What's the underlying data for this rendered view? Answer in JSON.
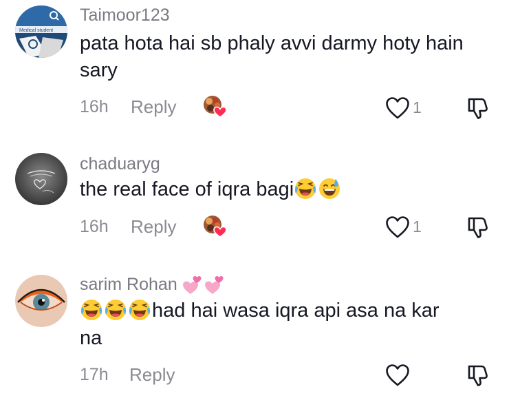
{
  "comments": [
    {
      "username": "Taimoor123",
      "avatar_text": "Medical student",
      "text": "pata hota hai sb phaly avvi darmy hoty hain sary",
      "time": "16h",
      "reply_label": "Reply",
      "like_count": "1"
    },
    {
      "username": "chaduaryg",
      "text": "the real face of iqra bagi",
      "time": "16h",
      "reply_label": "Reply",
      "like_count": "1"
    },
    {
      "username": "sarim Rohan",
      "text_line1": "had hai wasa iqra api asa na kar",
      "text_line2": "na",
      "time": "17h",
      "reply_label": "Reply",
      "like_count": ""
    }
  ],
  "icons": {
    "like": "heart-outline-icon",
    "dislike": "thumbs-down-icon",
    "creator_liked": "creator-liked-badge",
    "emoji_laughing": "tears-of-joy-emoji",
    "emoji_sweat": "grinning-sweat-emoji",
    "emoji_hearts": "two-hearts-emoji"
  },
  "colors": {
    "text": "#161823",
    "secondary": "#8a8b91",
    "heart_badge": "#fe2c55"
  }
}
